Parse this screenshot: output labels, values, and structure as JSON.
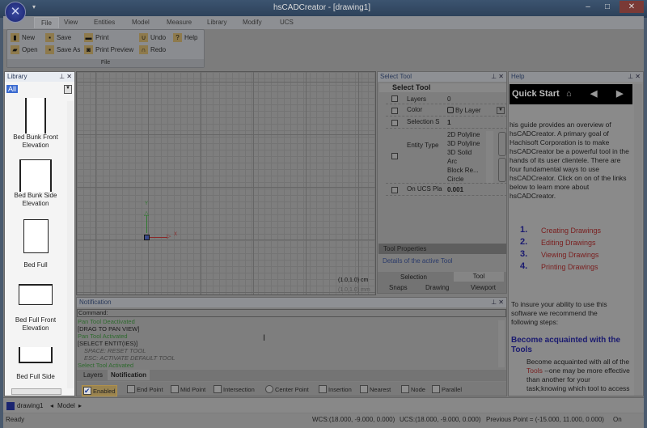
{
  "app": {
    "title": "hsCADCreator - [drawing1]",
    "quick_access": "▾"
  },
  "ribbon": {
    "tabs": [
      "File",
      "View",
      "Entities",
      "Model",
      "Measure",
      "Library",
      "Modify",
      "UCS"
    ],
    "group": "File",
    "buttons": {
      "new": "New",
      "open": "Open",
      "save": "Save",
      "save_as": "Save As",
      "print": "Print",
      "print_preview": "Print Preview",
      "undo": "Undo",
      "redo": "Redo",
      "help": "Help"
    }
  },
  "library": {
    "title": "Library",
    "filter": "All",
    "items": [
      "Bed Bunk Front Elevation",
      "Bed Bunk Side Elevation",
      "Bed Full",
      "Bed Full Front Elevation",
      "Bed Full Side"
    ]
  },
  "canvas": {
    "axis_x": "X",
    "axis_y": "Y",
    "scale_cm": "(1.0,1.0) cm",
    "scale_mm": "(1.0,1.0) mm"
  },
  "select_tool": {
    "panel_title": "Select Tool",
    "section": "Select Tool",
    "rows": [
      {
        "label": "Layers",
        "value": "0"
      },
      {
        "label": "Color",
        "value": "By Layer"
      },
      {
        "label": "Selection S",
        "value": "1"
      },
      {
        "label": "Entity Type",
        "value": ""
      },
      {
        "label": "On UCS Pla",
        "value": "0.001"
      }
    ],
    "entity_types": [
      "2D Polyline",
      "3D Polyline",
      "3D Solid",
      "Arc",
      "Block Re...",
      "Circle"
    ],
    "props_title": "Tool Properties",
    "props_desc": "Details of the active Tool",
    "tabs_top": [
      "Selection",
      "Tool"
    ],
    "tabs_bottom": [
      "Snaps",
      "Drawing",
      "Viewport"
    ]
  },
  "help": {
    "title": "Help",
    "quick_start": "Quick Start",
    "intro": "his guide provides an overview of hsCADCreator. A primary goal of Hachisoft Corporation is to make hsCADCreator be a powerful tool in the hands of its user clientele. There are four fundamental ways to use hsCADCreator. Click on on of the links below to learn more about hsCADCreator.",
    "links": [
      {
        "num": "1.",
        "text": "Creating Drawings"
      },
      {
        "num": "2.",
        "text": "Editing Drawings"
      },
      {
        "num": "3.",
        "text": "Viewing Drawings"
      },
      {
        "num": "4.",
        "text": "Printing Drawings"
      }
    ],
    "insure": "To insure your ability to use this software we recommend the following steps:",
    "heading": "Become acquainted with the Tools",
    "body_pre": "Become acquainted with all of the ",
    "body_link": "Tools",
    "body_post": " --one may be more effective than another for your task;knowing which tool to access and how to"
  },
  "notification": {
    "title": "Notification",
    "command_label": "Command:",
    "log": [
      {
        "text": "Pan Tool Deactivated",
        "kind": "green"
      },
      {
        "text": "[DRAG TO PAN VIEW]",
        "kind": "black"
      },
      {
        "text": "Pan Tool Activated",
        "kind": "green"
      },
      {
        "text": "[SELECT ENTIT(IES)]",
        "kind": "black"
      },
      {
        "text": "SPACE: RESET TOOL",
        "kind": "italic"
      },
      {
        "text": "ESC: ACTIVATE DEFAULT TOOL",
        "kind": "italic"
      },
      {
        "text": "Select Tool Activated",
        "kind": "green"
      }
    ],
    "tabs": [
      "Layers",
      "Notification"
    ],
    "snaps": [
      "Enabled",
      "End Point",
      "Mid Point",
      "Intersection",
      "Center Point",
      "Insertion",
      "Nearest",
      "Node",
      "Parallel"
    ]
  },
  "docbar": {
    "doc_tab": "drawing1",
    "layout_tab": "Model"
  },
  "status": {
    "ready": "Ready",
    "wcs": "WCS:(18.000, -9.000, 0.000)",
    "ucs": "UCS:(18.000, -9.000, 0.000)",
    "previous": "Previous Point = (-15.000, 11.000, 0.000)",
    "mode": "On"
  },
  "colors": {
    "log_green": "#2e6a2e",
    "link_red": "#7a2020",
    "heading_blue": "#1a1a70",
    "title_bar": "#2c4058"
  }
}
